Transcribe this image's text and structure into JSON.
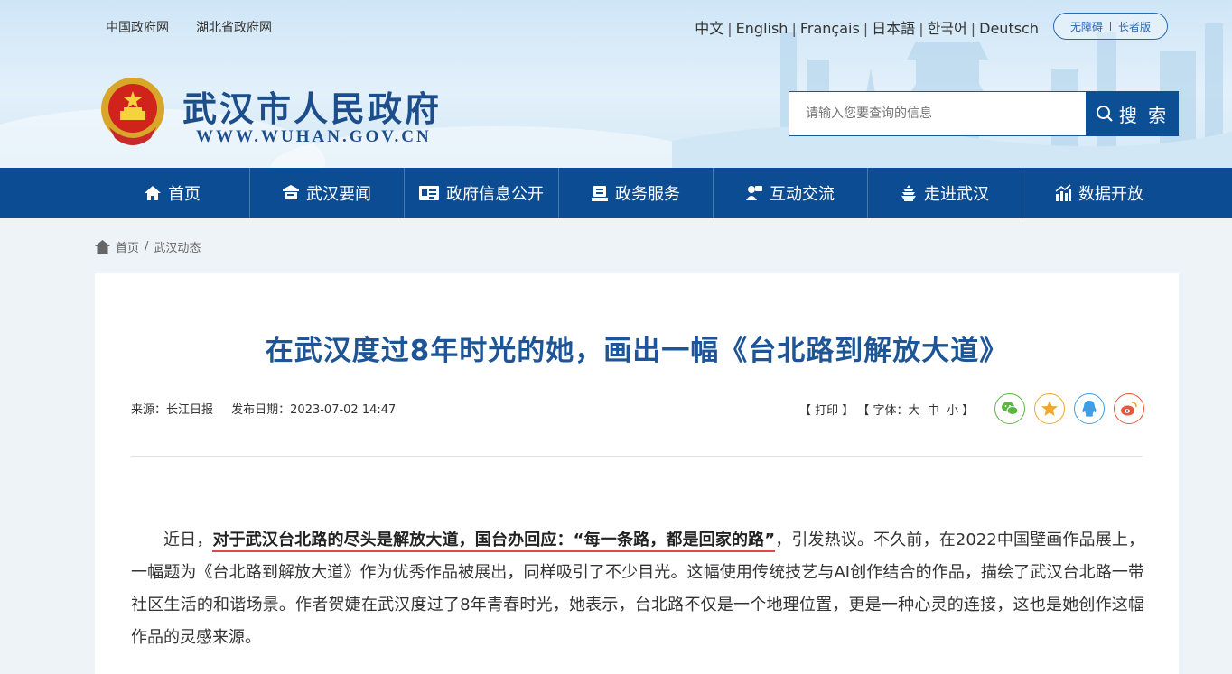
{
  "top_links": [
    "中国政府网",
    "湖北省政府网"
  ],
  "languages": [
    "中文",
    "English",
    "Français",
    "日本語",
    "한국어",
    "Deutsch"
  ],
  "accessibility": {
    "barrier_free": "无障碍",
    "elderly": "长者版"
  },
  "site": {
    "title": "武汉市人民政府",
    "url": "WWW.WUHAN.GOV.CN"
  },
  "search": {
    "placeholder": "请输入您要查询的信息",
    "button": "搜 索"
  },
  "nav": [
    {
      "label": "首页",
      "icon": "home-icon"
    },
    {
      "label": "武汉要闻",
      "icon": "news-icon"
    },
    {
      "label": "政府信息公开",
      "icon": "info-card-icon"
    },
    {
      "label": "政务服务",
      "icon": "service-icon"
    },
    {
      "label": "互动交流",
      "icon": "interaction-icon"
    },
    {
      "label": "走进武汉",
      "icon": "tower-icon"
    },
    {
      "label": "数据开放",
      "icon": "data-icon"
    }
  ],
  "breadcrumb": {
    "home": "首页",
    "sep": "/",
    "current": "武汉动态"
  },
  "article": {
    "title": "在武汉度过8年时光的她，画出一幅《台北路到解放大道》",
    "source": "来源：长江日报",
    "date": "发布日期：2023-07-02 14:47",
    "print": "【 打印 】",
    "font_size_label": "【 字体：",
    "font_sizes": [
      "大",
      "中",
      "小"
    ],
    "font_close": " 】",
    "body_lead": "近日，",
    "body_bold": "对于武汉台北路的尽头是解放大道，国台办回应：“每一条路，都是回家的路”",
    "body_rest": "，引发热议。不久前，在2022中国壁画作品展上，一幅题为《台北路到解放大道》作为优秀作品被展出，同样吸引了不少目光。这幅使用传统技艺与AI创作结合的作品，描绘了武汉台北路一带社区生活的和谐场景。作者贺婕在武汉度过了8年青春时光，她表示，台北路不仅是一个地理位置，更是一种心灵的连接，这也是她创作这幅作品的灵感来源。"
  },
  "share": [
    {
      "icon": "wechat-icon",
      "color": "#5bb541"
    },
    {
      "icon": "favorite-star-icon",
      "color": "#f0a92e"
    },
    {
      "icon": "qq-icon",
      "color": "#3e9ee6"
    },
    {
      "icon": "weibo-icon",
      "color": "#e8573d"
    }
  ]
}
